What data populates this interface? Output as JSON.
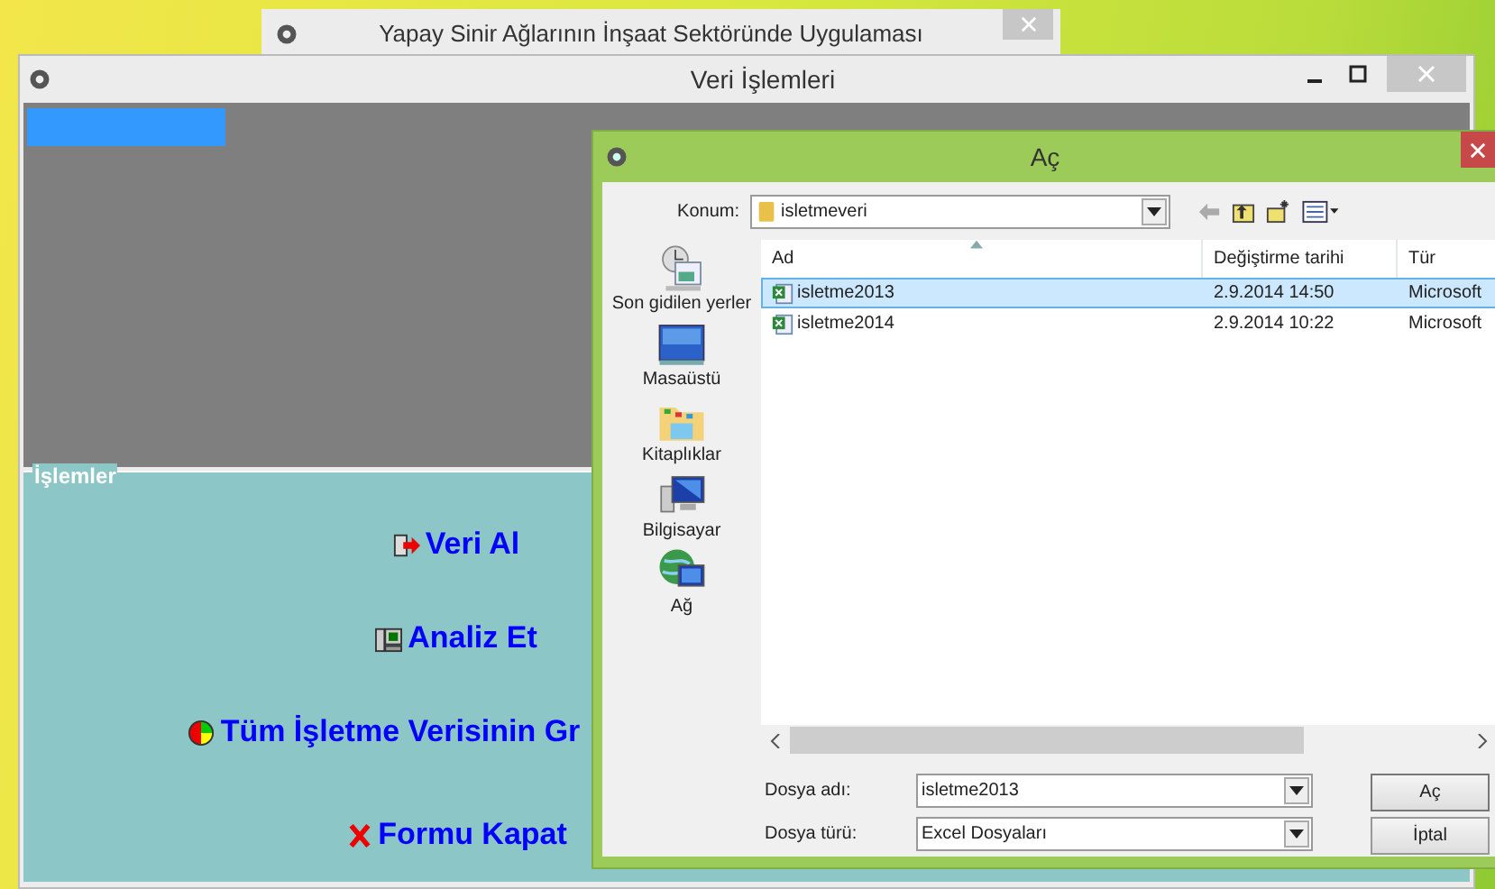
{
  "back_window": {
    "title": "Yapay Sinir Ağlarının İnşaat Sektöründe Uygulaması"
  },
  "main_window": {
    "title": "Veri İşlemleri",
    "group": {
      "title": "İşlemler",
      "actions": [
        {
          "label": "Veri Al",
          "kind": "import"
        },
        {
          "label": "Analiz Et",
          "kind": "analyze"
        },
        {
          "label": "Tüm İşletme Verisinin Gr",
          "kind": "chart"
        },
        {
          "label": "Formu Kapat",
          "kind": "close"
        }
      ]
    }
  },
  "dialog": {
    "title": "Aç",
    "location": {
      "label": "Konum:",
      "value": "isletmeveri"
    },
    "places": [
      {
        "label": "Son gidilen yerler",
        "kind": "recent"
      },
      {
        "label": "Masaüstü",
        "kind": "desktop"
      },
      {
        "label": "Kitaplıklar",
        "kind": "libraries"
      },
      {
        "label": "Bilgisayar",
        "kind": "computer"
      },
      {
        "label": "Ağ",
        "kind": "network"
      }
    ],
    "columns": [
      "Ad",
      "Değiştirme tarihi",
      "Tür"
    ],
    "files": [
      {
        "name": "isletme2013",
        "modified": "2.9.2014 14:50",
        "type": "Microsoft",
        "selected": true
      },
      {
        "name": "isletme2014",
        "modified": "2.9.2014 10:22",
        "type": "Microsoft",
        "selected": false
      }
    ],
    "file_name": {
      "label": "Dosya adı:",
      "value": "isletme2013"
    },
    "file_type": {
      "label": "Dosya türü:",
      "value": "Excel Dosyaları"
    },
    "buttons": [
      "Aç",
      "İptal"
    ]
  }
}
